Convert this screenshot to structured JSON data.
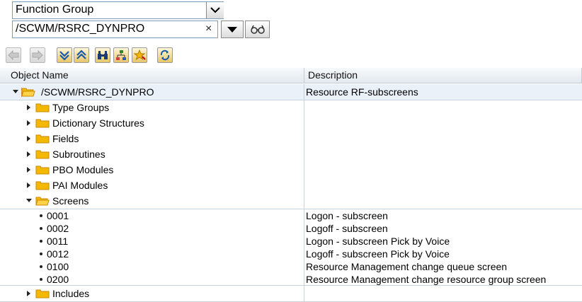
{
  "object_type": {
    "value": "Function Group"
  },
  "object_name": {
    "value": "/SCWM/RSRC_DYNPRO",
    "clear_symbol": "×"
  },
  "columns": {
    "name": "Object Name",
    "description": "Description"
  },
  "root": {
    "label": "/SCWM/RSRC_DYNPRO",
    "description": "Resource RF-subscreens"
  },
  "folders": [
    {
      "label": "Type Groups"
    },
    {
      "label": "Dictionary Structures"
    },
    {
      "label": "Fields"
    },
    {
      "label": "Subroutines"
    },
    {
      "label": "PBO Modules"
    },
    {
      "label": "PAI Modules"
    }
  ],
  "screens_folder": {
    "label": "Screens"
  },
  "screens": [
    {
      "id": "0001",
      "description": "Logon - subscreen"
    },
    {
      "id": "0002",
      "description": "Logoff - subscreen"
    },
    {
      "id": "0011",
      "description": "Logon - subscreen Pick by Voice"
    },
    {
      "id": "0012",
      "description": "Logoff - subscreen Pick by Voice"
    },
    {
      "id": "0100",
      "description": "Resource Management change queue screen"
    },
    {
      "id": "0200",
      "description": "Resource Management change resource group screen"
    }
  ],
  "includes_folder": {
    "label": "Includes"
  },
  "colors": {
    "folder": "#f5b800",
    "folder_edge": "#c98a00",
    "selected_row": "#eaf1f9",
    "grid": "#c9d3dd"
  }
}
